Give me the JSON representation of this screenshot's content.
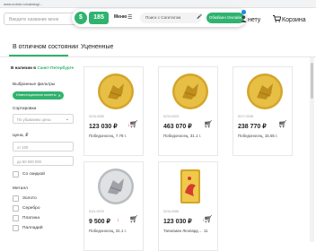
{
  "browser": {
    "url": "www.zoloto.ru/catalog/..."
  },
  "header": {
    "search_placeholder": "Введите название моне",
    "widget": {
      "badge": "185",
      "menu_label": "Меню",
      "search_text": "Поиск с Сагитатом",
      "online_button": "Обмбаен Онлайн"
    },
    "cart_prefix": "нету",
    "cart_label": "Корзина",
    "accent_color": "#2fb36f"
  },
  "tabs": [
    {
      "label": "В отличном состоянии",
      "active": true
    },
    {
      "label": "Уцененные",
      "active": false
    }
  ],
  "sidebar": {
    "availability_prefix": "В наличии в ",
    "availability_city": "Санкт-Петербурге",
    "filters_title": "Выбранные фильтры",
    "filter_chip": "Инвестиционные монеты",
    "sort_title": "Сортировка",
    "sort_value": "По убыванию цены",
    "price_title": "Цена, ₽",
    "price_from": "от 100",
    "price_to": "до 50 000 000",
    "discount_label": "Со скидкой",
    "metal_title": "Металл",
    "metals": [
      "Золото",
      "Серебро",
      "Платина",
      "Палладий"
    ]
  },
  "products": [
    {
      "article": "5216-0060",
      "price": "123 030 ₽",
      "desc": "Победоносец, 7.78 г.",
      "metal": "gold"
    },
    {
      "article": "5219-0003",
      "price": "463 070 ₽",
      "desc": "Победоносец, 31.1 г.",
      "metal": "gold"
    },
    {
      "article": "5217-0098",
      "price": "238 770 ₽",
      "desc": "Победоносец, 15.55 г.",
      "metal": "gold"
    },
    {
      "article": "5111-0078",
      "price": "9 500 ₽",
      "desc": "Победоносец, 31.1 г.",
      "metal": "silver"
    },
    {
      "article": "5216-0066",
      "price": "123 030 ₽",
      "desc": "Талисман Леопард ... 11",
      "metal": "gold-bar"
    }
  ]
}
